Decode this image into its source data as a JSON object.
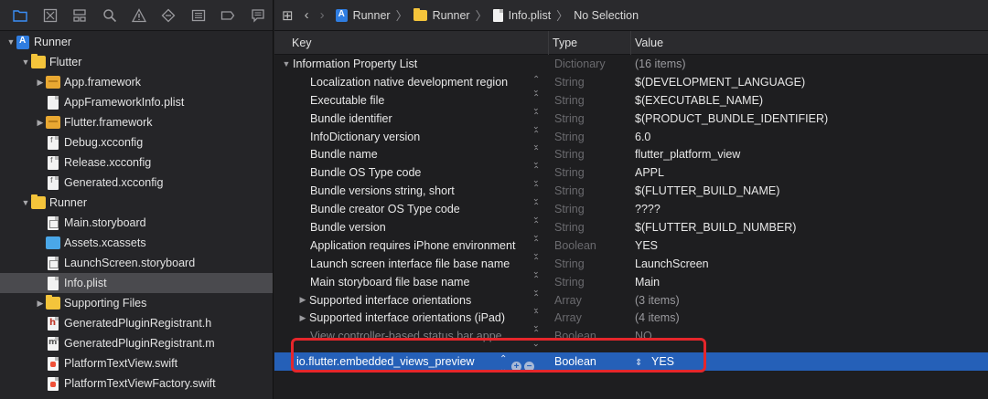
{
  "navigator": {
    "toolbar_icons": [
      "folder-icon",
      "source-control-icon",
      "hierarchy-icon",
      "search-icon",
      "warning-icon",
      "test-icon",
      "debug-icon",
      "breakpoint-icon",
      "report-icon"
    ],
    "tree": [
      {
        "label": "Runner",
        "depth": 0,
        "disclosure": "open",
        "icon": "project"
      },
      {
        "label": "Flutter",
        "depth": 1,
        "disclosure": "open",
        "icon": "folder"
      },
      {
        "label": "App.framework",
        "depth": 2,
        "disclosure": "closed",
        "icon": "framework"
      },
      {
        "label": "AppFrameworkInfo.plist",
        "depth": 2,
        "disclosure": "",
        "icon": "doc"
      },
      {
        "label": "Flutter.framework",
        "depth": 2,
        "disclosure": "closed",
        "icon": "framework"
      },
      {
        "label": "Debug.xcconfig",
        "depth": 2,
        "disclosure": "",
        "icon": "cfg"
      },
      {
        "label": "Release.xcconfig",
        "depth": 2,
        "disclosure": "",
        "icon": "cfg"
      },
      {
        "label": "Generated.xcconfig",
        "depth": 2,
        "disclosure": "",
        "icon": "cfg"
      },
      {
        "label": "Runner",
        "depth": 1,
        "disclosure": "open",
        "icon": "folder"
      },
      {
        "label": "Main.storyboard",
        "depth": 2,
        "disclosure": "",
        "icon": "sb"
      },
      {
        "label": "Assets.xcassets",
        "depth": 2,
        "disclosure": "",
        "icon": "assets"
      },
      {
        "label": "LaunchScreen.storyboard",
        "depth": 2,
        "disclosure": "",
        "icon": "sb"
      },
      {
        "label": "Info.plist",
        "depth": 2,
        "disclosure": "",
        "icon": "doc",
        "selected": true
      },
      {
        "label": "Supporting Files",
        "depth": 2,
        "disclosure": "closed",
        "icon": "folder"
      },
      {
        "label": "GeneratedPluginRegistrant.h",
        "depth": 2,
        "disclosure": "",
        "icon": "h"
      },
      {
        "label": "GeneratedPluginRegistrant.m",
        "depth": 2,
        "disclosure": "",
        "icon": "m"
      },
      {
        "label": "PlatformTextView.swift",
        "depth": 2,
        "disclosure": "",
        "icon": "swift"
      },
      {
        "label": "PlatformTextViewFactory.swift",
        "depth": 2,
        "disclosure": "",
        "icon": "swift"
      }
    ]
  },
  "jumpbar": {
    "crumbs": [
      "Runner",
      "Runner",
      "Info.plist",
      "No Selection"
    ]
  },
  "plist": {
    "headers": {
      "key": "Key",
      "type": "Type",
      "value": "Value"
    },
    "rows": [
      {
        "key": "Information Property List",
        "type": "Dictionary",
        "value": "(16 items)",
        "root": true
      },
      {
        "key": "Localization native development region",
        "type": "String",
        "value": "$(DEVELOPMENT_LANGUAGE)"
      },
      {
        "key": "Executable file",
        "type": "String",
        "value": "$(EXECUTABLE_NAME)"
      },
      {
        "key": "Bundle identifier",
        "type": "String",
        "value": "$(PRODUCT_BUNDLE_IDENTIFIER)"
      },
      {
        "key": "InfoDictionary version",
        "type": "String",
        "value": "6.0"
      },
      {
        "key": "Bundle name",
        "type": "String",
        "value": "flutter_platform_view"
      },
      {
        "key": "Bundle OS Type code",
        "type": "String",
        "value": "APPL"
      },
      {
        "key": "Bundle versions string, short",
        "type": "String",
        "value": "$(FLUTTER_BUILD_NAME)"
      },
      {
        "key": "Bundle creator OS Type code",
        "type": "String",
        "value": "????"
      },
      {
        "key": "Bundle version",
        "type": "String",
        "value": "$(FLUTTER_BUILD_NUMBER)"
      },
      {
        "key": "Application requires iPhone environment",
        "type": "Boolean",
        "value": "YES"
      },
      {
        "key": "Launch screen interface file base name",
        "type": "String",
        "value": "LaunchScreen"
      },
      {
        "key": "Main storyboard file base name",
        "type": "String",
        "value": "Main"
      },
      {
        "key": "Supported interface orientations",
        "type": "Array",
        "value": "(3 items)",
        "expandable": true
      },
      {
        "key": "Supported interface orientations (iPad)",
        "type": "Array",
        "value": "(4 items)",
        "expandable": true
      },
      {
        "key": "View controller-based status bar appe...",
        "type": "Boolean",
        "value": "NO",
        "faded": true
      },
      {
        "key": "io.flutter.embedded_views_preview",
        "type": "Boolean",
        "value": "YES",
        "selected": true
      }
    ]
  },
  "colors": {
    "selection": "#2560b8",
    "highlight_box": "#e5262b",
    "accent": "#3a8ef6"
  }
}
